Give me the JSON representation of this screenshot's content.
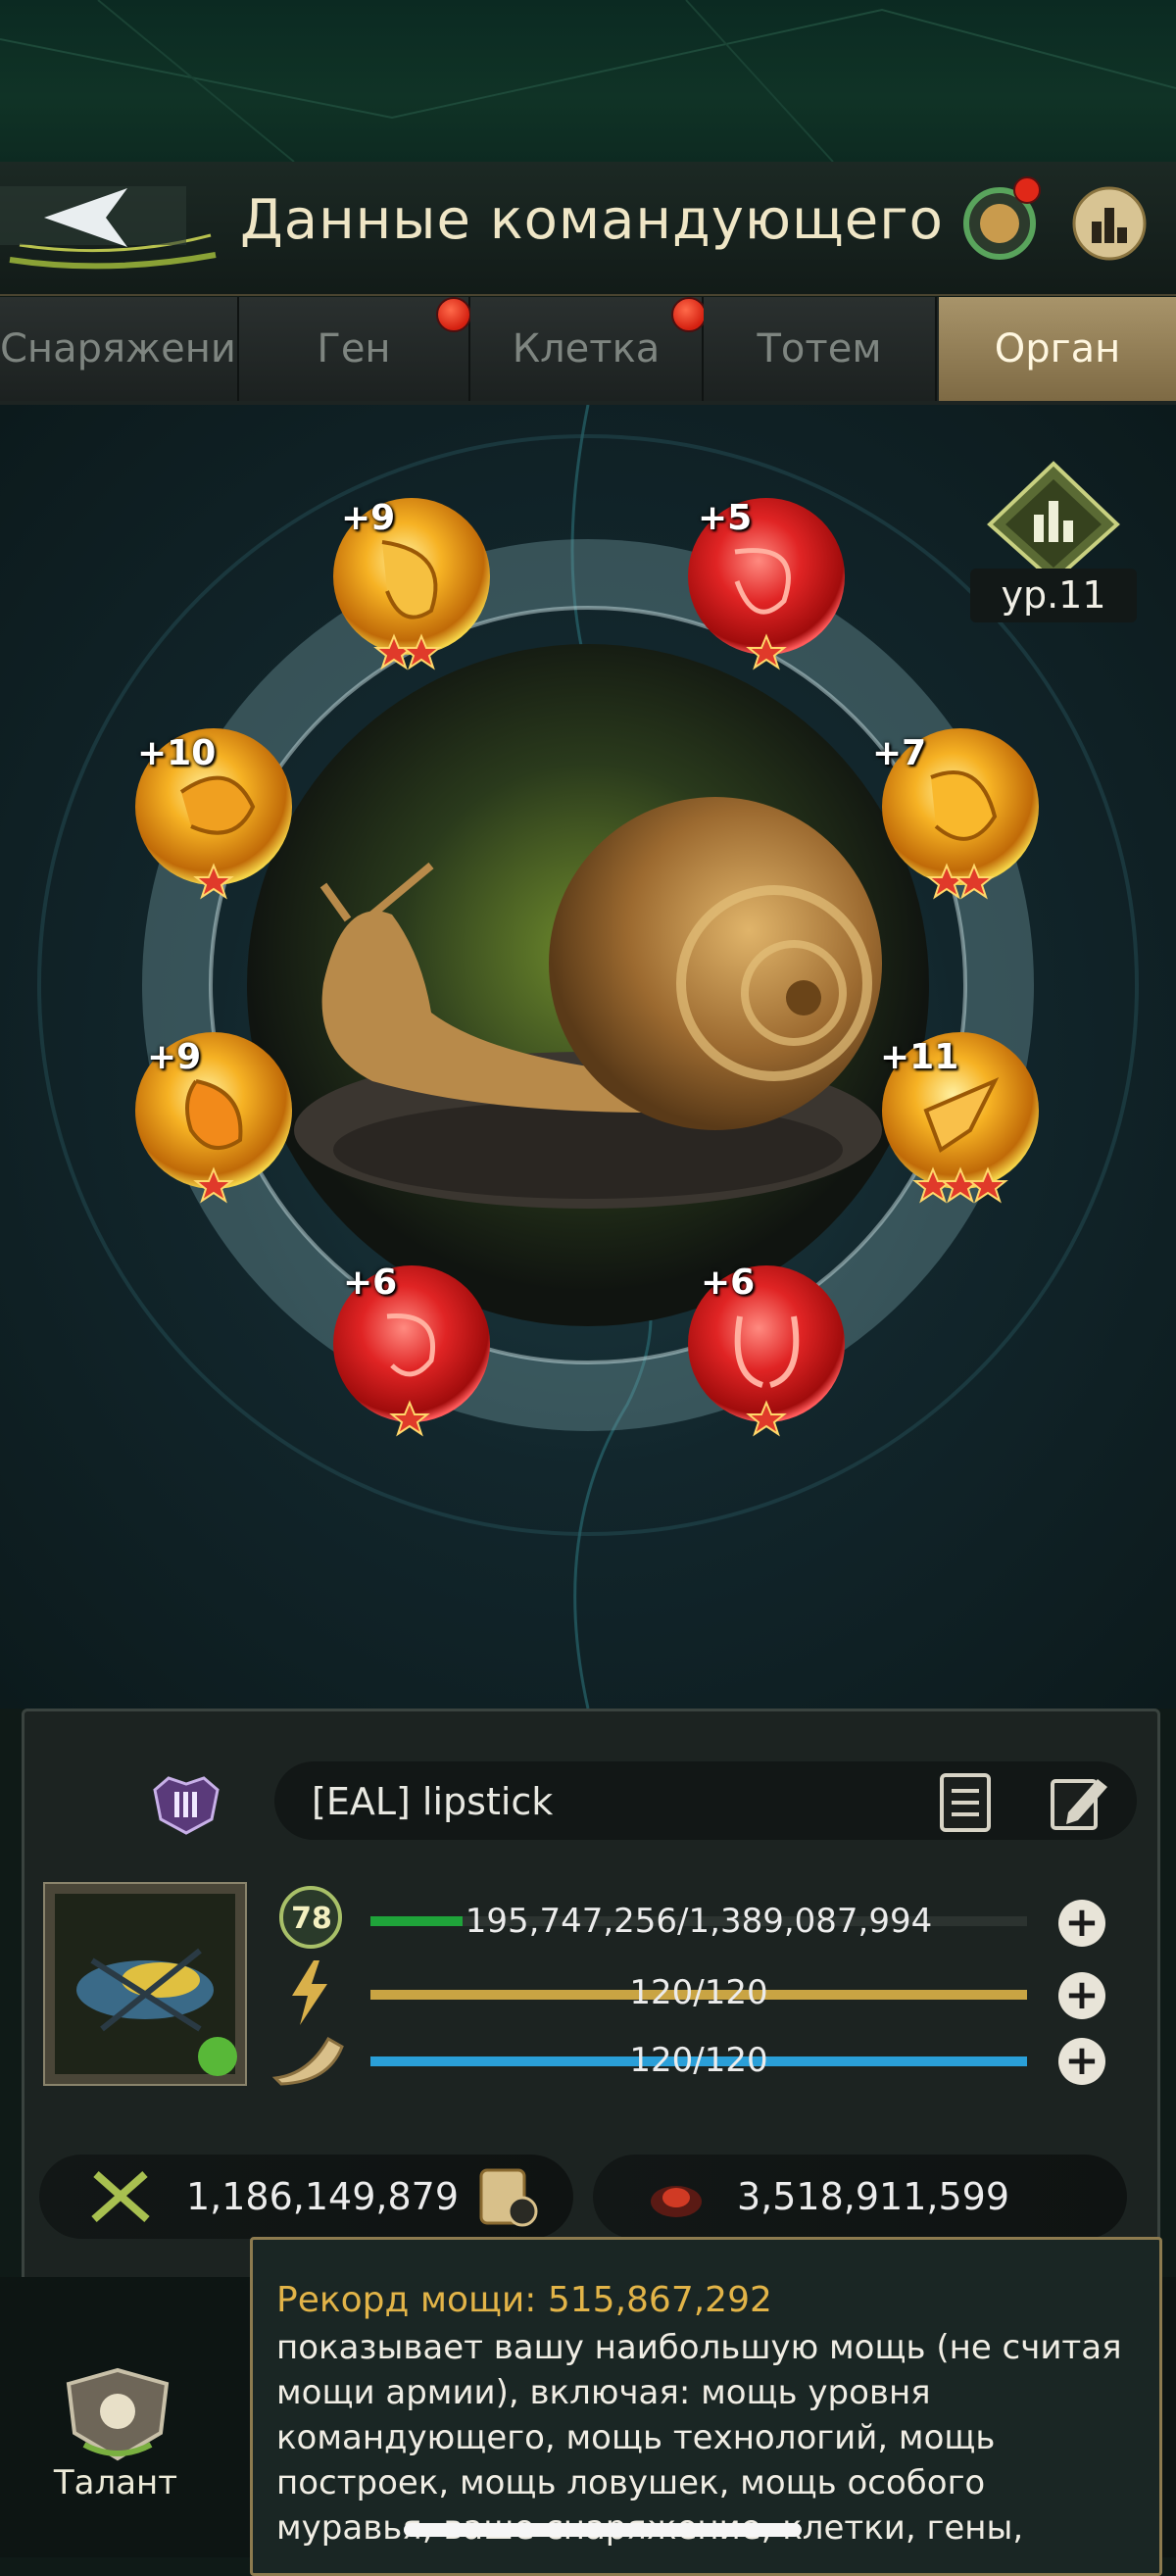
{
  "header": {
    "title": "Данные командующего"
  },
  "tabs": [
    {
      "label": "Снаряжение",
      "notification": false,
      "active": false
    },
    {
      "label": "Ген",
      "notification": true,
      "active": false
    },
    {
      "label": "Клетка",
      "notification": true,
      "active": false
    },
    {
      "label": "Тотем",
      "notification": false,
      "active": false
    },
    {
      "label": "Орган",
      "notification": false,
      "active": true
    }
  ],
  "organ": {
    "level": "ур.11",
    "creature": "snail",
    "slots": [
      {
        "label": "+9",
        "color": "gold",
        "stars": 2
      },
      {
        "label": "+5",
        "color": "red",
        "stars": 1
      },
      {
        "label": "+10",
        "color": "gold",
        "stars": 1
      },
      {
        "label": "+7",
        "color": "gold",
        "stars": 2
      },
      {
        "label": "+9",
        "color": "gold",
        "stars": 1
      },
      {
        "label": "+11",
        "color": "gold",
        "stars": 3
      },
      {
        "label": "+6",
        "color": "red",
        "stars": 1
      },
      {
        "label": "+6",
        "color": "red",
        "stars": 1
      }
    ]
  },
  "profile": {
    "rank": "III",
    "name": "[EAL]  lipstick",
    "level": "78",
    "exp": {
      "text": "195,747,256/1,389,087,994",
      "fraction": 0.141
    },
    "energy": {
      "text": "120/120",
      "fraction": 1.0
    },
    "stamina": {
      "text": "120/120",
      "fraction": 1.0
    },
    "power": "1,186,149,879",
    "kills": "3,518,911,599"
  },
  "talent": {
    "label": "Талант"
  },
  "tooltip": {
    "title": "Рекорд мощи: 515,867,292",
    "body": "показывает вашу наибольшую мощь (не считая мощи армии), включая: мощь уровня командующего, мощь технологий, мощь построек, мощь ловушек, мощь особого муравья, ваше снаряжение, клетки, гены,"
  },
  "colors": {
    "gold": "#f3b21f",
    "red": "#e42a2a",
    "exp_bar": "#1fa43a",
    "energy_bar": "#c9a443",
    "stamina_bar": "#2a9fd8",
    "tooltip_title": "#e2b448",
    "active_tab": "#a8946a"
  }
}
